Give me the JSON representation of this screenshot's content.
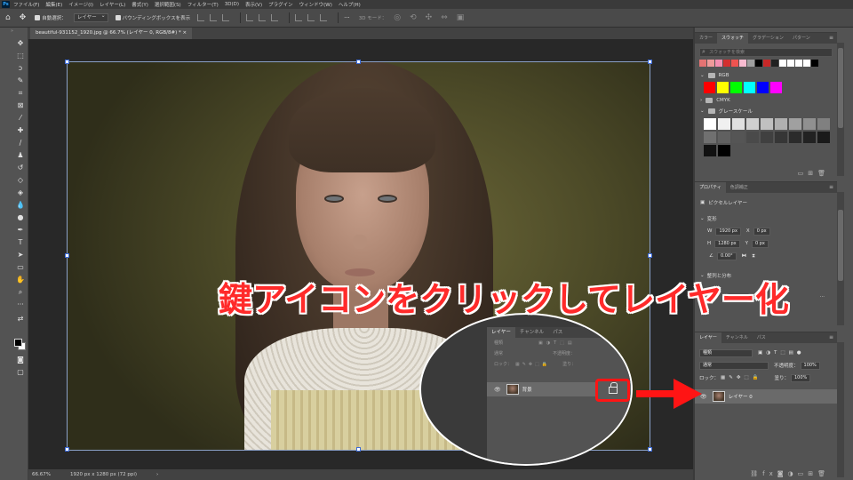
{
  "menubar": {
    "items": [
      "ファイル(F)",
      "編集(E)",
      "イメージ(I)",
      "レイヤー(L)",
      "書式(Y)",
      "選択範囲(S)",
      "フィルター(T)",
      "3D(D)",
      "表示(V)",
      "プラグイン",
      "ウィンドウ(W)",
      "ヘルプ(H)"
    ]
  },
  "options": {
    "auto_select": "自動選択：",
    "layer_select": "レイヤー",
    "bbox": "バウンディングボックスを表示",
    "mode3d": "3D モード："
  },
  "document": {
    "tab": "beautiful-931152_1920.jpg @ 66.7% (レイヤー 0, RGB/8#) *"
  },
  "status": {
    "zoom": "66.67%",
    "size": "1920 px x 1280 px (72 ppi)"
  },
  "swatches_panel": {
    "tabs": [
      "カラー",
      "スウォッチ",
      "グラデーション",
      "パターン"
    ],
    "search_placeholder": "スウォッチを検索",
    "groups": [
      "RGB",
      "CMYK",
      "グレースケール"
    ],
    "recent_colors": [
      "#e57373",
      "#ef9a9a",
      "#f48fb1",
      "#d32f2f",
      "#ef5350",
      "#f8bbd0",
      "#9e9e9e",
      "#000000",
      "#c62828",
      "#212121",
      "#ffffff",
      "#ffffff",
      "#ffffff",
      "#ffffff",
      "#000000"
    ],
    "rgb_colors": [
      "#ff0000",
      "#ffff00",
      "#00ff00",
      "#00ffff",
      "#0000ff",
      "#ff00ff"
    ],
    "gray_colors": [
      "#ffffff",
      "#f0f0f0",
      "#e0e0e0",
      "#d0d0d0",
      "#c0c0c0",
      "#b0b0b0",
      "#a0a0a0",
      "#909090",
      "#808080",
      "#707070",
      "#606060",
      "#555555",
      "#4a4a4a",
      "#404040",
      "#363636",
      "#2b2b2b",
      "#222222",
      "#1a1a1a",
      "#111111",
      "#000000"
    ]
  },
  "properties_panel": {
    "tabs": [
      "プロパティ",
      "色調補正"
    ],
    "layer_type": "ピクセルレイヤー",
    "transform": "変形",
    "w": "1920 px",
    "h": "1280 px",
    "x": "0 px",
    "y": "0 px",
    "angle": "0.00°",
    "align": "整列と分布"
  },
  "layers_panel": {
    "tabs": [
      "レイヤー",
      "チャンネル",
      "パス"
    ],
    "kind": "種類",
    "blend": "通常",
    "opacity_label": "不透明度：",
    "opacity": "100%",
    "lock_label": "ロック：",
    "fill_label": "塗り：",
    "fill": "100%",
    "layer_name": "レイヤー 0"
  },
  "inset": {
    "tabs": [
      "レイヤー",
      "チャンネル",
      "パス"
    ],
    "kind": "種類",
    "blend": "通常",
    "opacity_label": "不透明度：",
    "lock_label": "ロック：",
    "fill_label": "塗り：",
    "layer_name": "背景"
  },
  "caption": "鍵アイコンをクリックしてレイヤー化",
  "colors": {
    "accent_red": "#ff1414",
    "ui_dark": "#535353"
  }
}
